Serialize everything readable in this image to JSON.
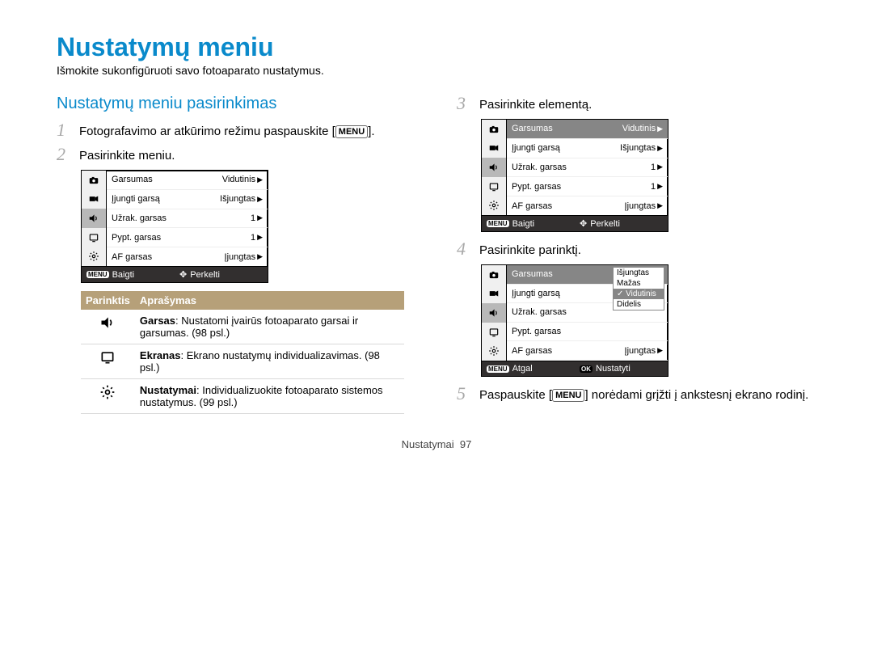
{
  "title": "Nustatymų meniu",
  "intro": "Išmokite sukonfigūruoti savo fotoaparato nustatymus.",
  "subheading": "Nustatymų meniu pasirinkimas",
  "menu_chip": "MENU",
  "ok_chip": "OK",
  "steps": {
    "s1a": "Fotografavimo ar atkūrimo režimu paspauskite [",
    "s1b": "].",
    "s2": "Pasirinkite meniu.",
    "s3": "Pasirinkite elementą.",
    "s4": "Pasirinkite parinktį.",
    "s5a": "Paspauskite [",
    "s5b": "] norėdami grįžti į ankstesnį ekrano rodinį."
  },
  "screen_rows": {
    "garsumas": "Garsumas",
    "ijungti": "Įjungti garsą",
    "uzrak": "Užrak. garsas",
    "pypt": "Pypt. garsas",
    "af": "AF garsas",
    "vidutinis": "Vidutinis",
    "isjungtas": "Išjungtas",
    "ijungtas": "Įjungtas",
    "mazas": "Mažas",
    "didelis": "Didelis",
    "one": "1"
  },
  "screen_footer": {
    "baigti": "Baigti",
    "perkelti": "Perkelti",
    "atgal": "Atgal",
    "nustatyti": "Nustatyti"
  },
  "opt_header": {
    "col1": "Parinktis",
    "col2": "Aprašymas"
  },
  "options": {
    "garsas_t": "Garsas",
    "garsas_d": ": Nustatomi įvairūs fotoaparato garsai ir garsumas. (98 psl.)",
    "ekranas_t": "Ekranas",
    "ekranas_d": ": Ekrano nustatymų individualizavimas. (98 psl.)",
    "nust_t": "Nustatymai",
    "nust_d": ": Individualizuokite fotoaparato sistemos nustatymus. (99 psl.)"
  },
  "footer": {
    "section": "Nustatymai",
    "page": "97"
  }
}
